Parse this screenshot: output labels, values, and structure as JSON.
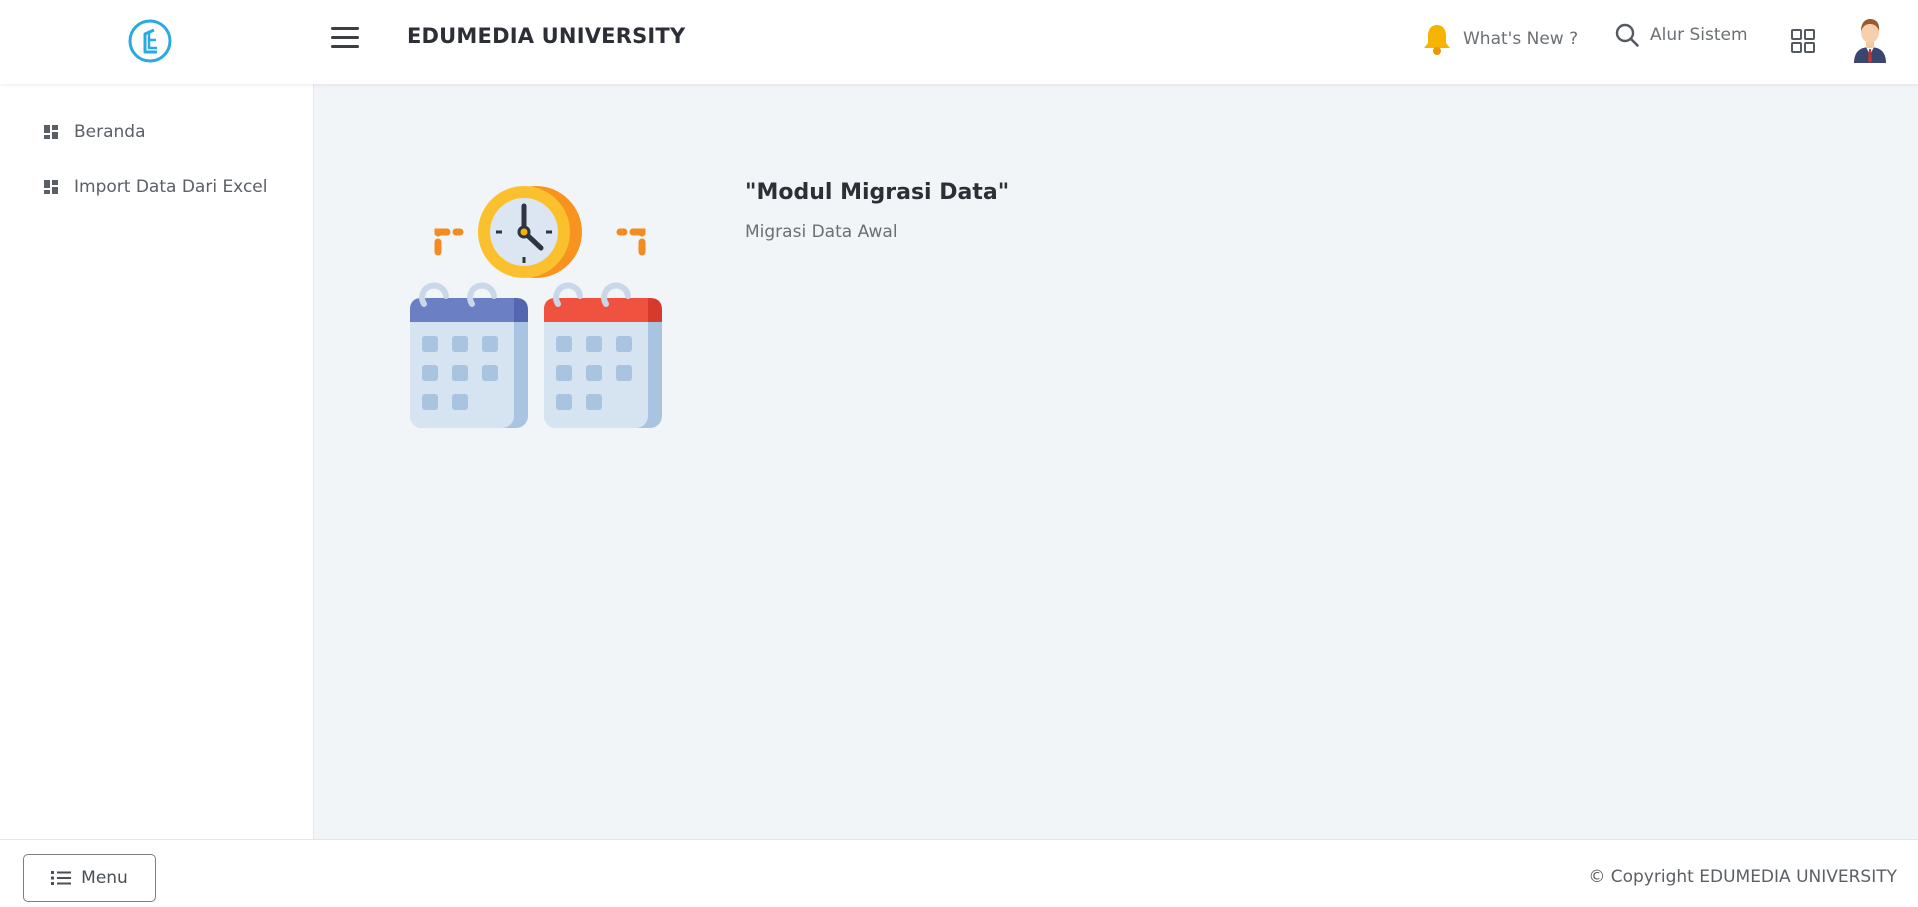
{
  "header": {
    "title": "EDUMEDIA UNIVERSITY",
    "whats_new_label": "What's New ?",
    "alur_label": "Alur Sistem",
    "accent_color": "#2ba9e1",
    "bell_color": "#f5b400"
  },
  "sidebar": {
    "items": [
      {
        "label": "Beranda",
        "icon": "dashboard-icon"
      },
      {
        "label": "Import Data Dari Excel",
        "icon": "dashboard-icon"
      }
    ]
  },
  "main": {
    "module_title": "\"Modul Migrasi Data\"",
    "module_subtitle": "Migrasi Data Awal"
  },
  "footer": {
    "menu_label": "Menu",
    "copyright": "© Copyright EDUMEDIA UNIVERSITY"
  }
}
